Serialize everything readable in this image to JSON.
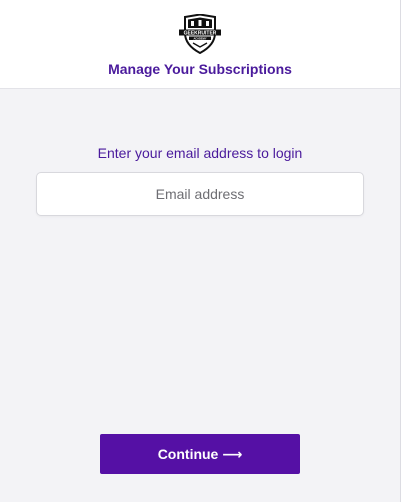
{
  "header": {
    "logo": {
      "icon": "geekruiter-shield-logo",
      "text": "GEEKRUITER",
      "subtext": "ACADEMY"
    },
    "title": "Manage Your Subscriptions"
  },
  "login": {
    "prompt": "Enter your email address to login",
    "email": {
      "value": "",
      "placeholder": "Email address"
    },
    "continue_label": "Continue ⟶"
  },
  "colors": {
    "accent": "#4a1a9c",
    "button": "#5510a5",
    "page_bg": "#f3f3f6",
    "header_bg": "#ffffff"
  }
}
